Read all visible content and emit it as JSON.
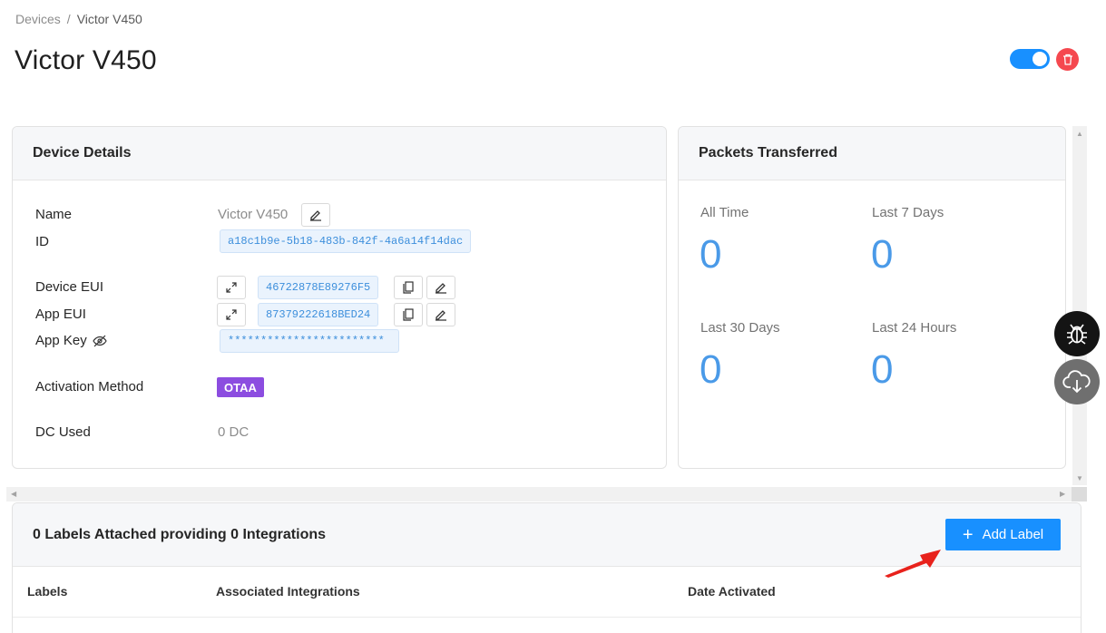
{
  "breadcrumb": {
    "parent": "Devices",
    "separator": "/",
    "current": "Victor V450"
  },
  "page_title": "Victor V450",
  "device_active": true,
  "colors": {
    "accent": "#1890ff",
    "danger": "#f5484f",
    "badge": "#8c4de0",
    "stat": "#4a9ae8"
  },
  "device_details": {
    "title": "Device Details",
    "name_label": "Name",
    "name_value": "Victor V450",
    "id_label": "ID",
    "id_value": "a18c1b9e-5b18-483b-842f-4a6a14f14dac",
    "dev_eui_label": "Device EUI",
    "dev_eui_value": "46722878E89276F5",
    "app_eui_label": "App EUI",
    "app_eui_value": "87379222618BED24",
    "app_key_label": "App Key",
    "app_key_value": "************************",
    "activation_label": "Activation Method",
    "activation_value": "OTAA",
    "dc_label": "DC Used",
    "dc_value": "0 DC"
  },
  "packets": {
    "title": "Packets Transferred",
    "stats": [
      {
        "label": "All Time",
        "value": "0"
      },
      {
        "label": "Last 7 Days",
        "value": "0"
      },
      {
        "label": "Last 30 Days",
        "value": "0"
      },
      {
        "label": "Last 24 Hours",
        "value": "0"
      }
    ]
  },
  "labels_section": {
    "title": "0 Labels Attached providing 0 Integrations",
    "add_button": "Add Label",
    "columns": [
      "Labels",
      "Associated Integrations",
      "Date Activated"
    ]
  },
  "icons": [
    "trash-icon",
    "edit-icon",
    "expand-icon",
    "copy-icon",
    "eye-slash-icon",
    "bug-icon",
    "cloud-download-icon",
    "plus-icon"
  ]
}
